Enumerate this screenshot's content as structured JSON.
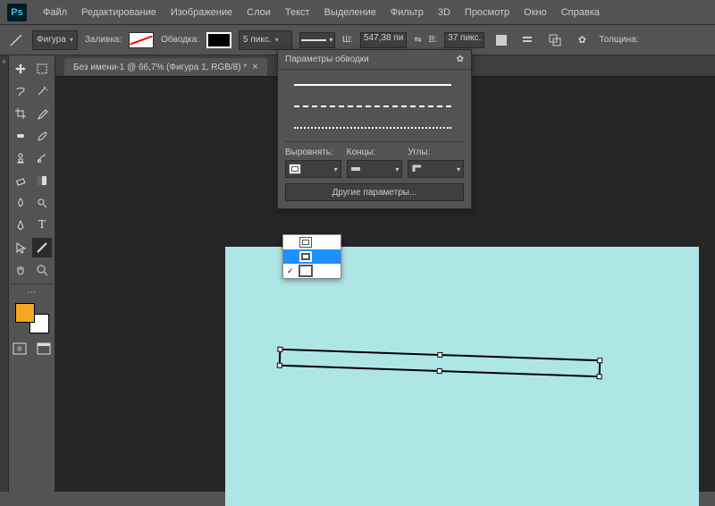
{
  "app": {
    "logo": "Ps"
  },
  "menu": {
    "file": "Файл",
    "edit": "Редактирование",
    "image": "Изображение",
    "layer": "Слои",
    "text": "Текст",
    "select": "Выделение",
    "filter": "Фильтр",
    "3d": "3D",
    "view": "Просмотр",
    "window": "Окно",
    "help": "Справка"
  },
  "options": {
    "mode": "Фигура",
    "fill_label": "Заливка:",
    "stroke_label": "Обводка:",
    "stroke_width": "5 пикс.",
    "w_label": "Ш:",
    "w_value": "547,38 пи",
    "link": "⇋",
    "h_label": "В:",
    "h_value": "37 пикс.",
    "thickness_label": "Толщина:"
  },
  "tab": {
    "title": "Без имени-1 @ 66,7% (Фигура 1, RGB/8) *",
    "close": "×"
  },
  "panel": {
    "title": "Параметры обводки",
    "gear": "✿",
    "align_label": "Выровнять:",
    "caps_label": "Концы:",
    "corners_label": "Углы:",
    "more": "Другие параметры..."
  },
  "align_options": [
    "inside",
    "center",
    "outside"
  ],
  "align_selected": 1
}
